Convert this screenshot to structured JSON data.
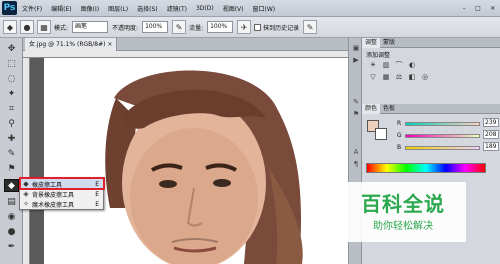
{
  "app": {
    "logo": "Ps"
  },
  "menu": [
    "文件(F)",
    "编辑(E)",
    "图像(I)",
    "图层(L)",
    "选择(S)",
    "滤镜(T)",
    "3D(D)",
    "视图(V)",
    "窗口(W)"
  ],
  "options_bar": {
    "mode_label": "模式:",
    "mode_value": "画笔",
    "opacity_label": "不透明度:",
    "opacity_value": "100%",
    "flow_label": "流量:",
    "flow_value": "100%",
    "erase_history_label": "抹到历史记录"
  },
  "document": {
    "tab_label": "女.jpg @ 71.1% (RGB/8#) ×"
  },
  "tool_flyout": {
    "items": [
      {
        "label": "橡皮擦工具",
        "shortcut": "E",
        "icon": "eraser-icon"
      },
      {
        "label": "背景橡皮擦工具",
        "shortcut": "E",
        "icon": "background-eraser-icon"
      },
      {
        "label": "魔术橡皮擦工具",
        "shortcut": "E",
        "icon": "magic-eraser-icon"
      }
    ]
  },
  "panels": {
    "adjust_tabs": [
      "调整",
      "蒙版"
    ],
    "adjust_title": "添加调整",
    "color_tabs": [
      "颜色",
      "色板"
    ],
    "sliders": [
      {
        "label": "R",
        "value": "239"
      },
      {
        "label": "G",
        "value": "208"
      },
      {
        "label": "B",
        "value": "189"
      }
    ],
    "foreground_color": "#efd0bd"
  },
  "watermark": {
    "title": "百科全说",
    "subtitle": "助你轻松解决"
  }
}
